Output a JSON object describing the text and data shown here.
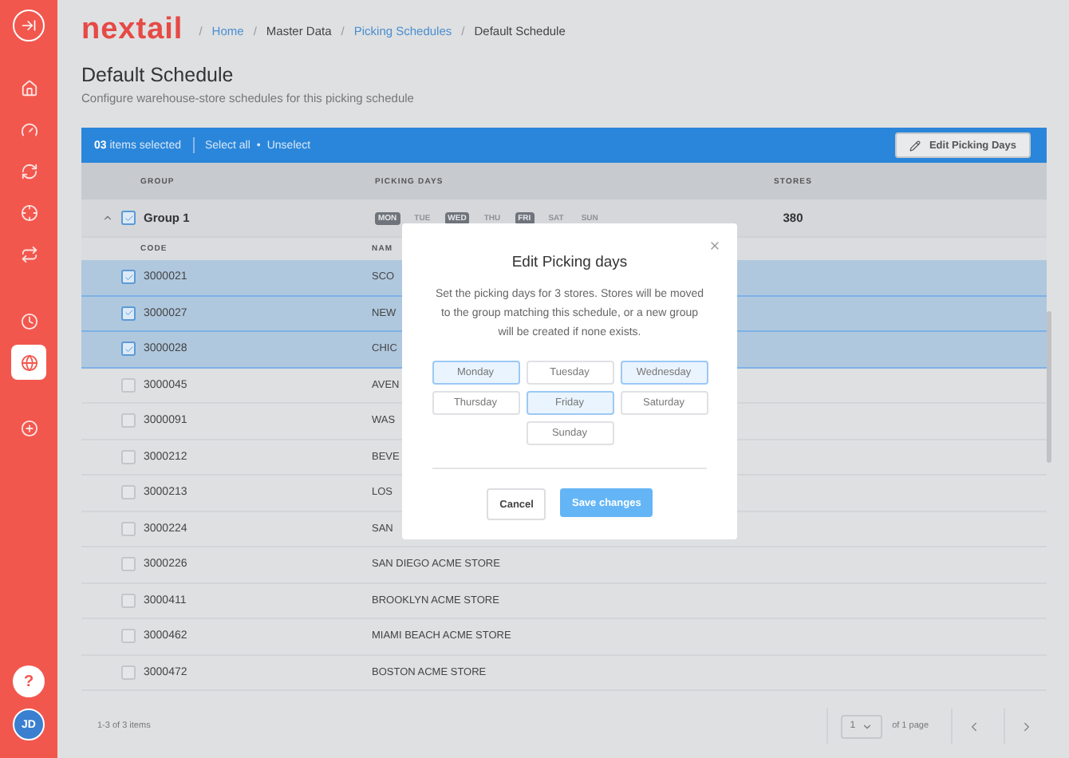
{
  "sidebar": {
    "items": [
      {
        "kind": "home",
        "selected": false
      },
      {
        "kind": "gauge",
        "selected": false
      },
      {
        "kind": "refresh",
        "selected": false
      },
      {
        "kind": "target",
        "selected": false
      },
      {
        "kind": "repeat",
        "selected": false
      },
      {
        "kind": "clock",
        "selected": false
      },
      {
        "kind": "globe",
        "selected": true
      },
      {
        "kind": "plus",
        "selected": false
      }
    ],
    "help": "?",
    "avatar": "JD"
  },
  "header": {
    "logo": "nextail",
    "separator": "/",
    "breadcrumb": [
      {
        "label": "Home",
        "link": true
      },
      {
        "label": "Master Data",
        "link": false
      },
      {
        "label": "Picking Schedules",
        "link": true
      },
      {
        "label": "Default Schedule",
        "link": false
      }
    ]
  },
  "page": {
    "title": "Default Schedule",
    "subtitle": "Configure warehouse-store schedules for this picking schedule"
  },
  "selection_bar": {
    "count": "03",
    "count_label": "items selected",
    "select_all": "Select all",
    "separator": "•",
    "unselect": "Unselect",
    "action": "Edit Picking Days"
  },
  "table": {
    "columns": [
      "GROUP",
      "PICKING DAYS",
      "STORES"
    ],
    "group": {
      "name": "Group 1",
      "expanded": true,
      "checked": true,
      "stores": "380",
      "days": [
        {
          "label": "MON",
          "selected": true
        },
        {
          "label": "TUE",
          "selected": false
        },
        {
          "label": "WED",
          "selected": true
        },
        {
          "label": "THU",
          "selected": false
        },
        {
          "label": "FRI",
          "selected": true
        },
        {
          "label": "SAT",
          "selected": false
        },
        {
          "label": "SUN",
          "selected": false
        }
      ]
    },
    "sub_columns": [
      "CODE",
      "NAM"
    ],
    "rows": [
      {
        "code": "3000021",
        "name": "SCO",
        "checked": true
      },
      {
        "code": "3000027",
        "name": "NEW",
        "checked": true
      },
      {
        "code": "3000028",
        "name": "CHIC",
        "checked": true
      },
      {
        "code": "3000045",
        "name": "AVEN",
        "checked": false
      },
      {
        "code": "3000091",
        "name": "WAS",
        "checked": false
      },
      {
        "code": "3000212",
        "name": "BEVE",
        "checked": false
      },
      {
        "code": "3000213",
        "name": "LOS",
        "checked": false
      },
      {
        "code": "3000224",
        "name": "SAN",
        "checked": false
      },
      {
        "code": "3000226",
        "name": "SAN DIEGO ACME STORE",
        "checked": false
      },
      {
        "code": "3000411",
        "name": "BROOKLYN ACME STORE",
        "checked": false
      },
      {
        "code": "3000462",
        "name": "MIAMI BEACH ACME STORE",
        "checked": false
      },
      {
        "code": "3000472",
        "name": "BOSTON ACME STORE",
        "checked": false
      }
    ],
    "summary": "1-3 of 3 items",
    "page_select": "1",
    "page_total": "of 1 page"
  },
  "dialog": {
    "title": "Edit Picking days",
    "text": "Set the picking days for 3 stores. Stores will be moved to the group matching this schedule, or a new group will be created if none exists.",
    "days": [
      {
        "label": "Monday",
        "selected": true
      },
      {
        "label": "Tuesday",
        "selected": false
      },
      {
        "label": "Wednesday",
        "selected": true
      },
      {
        "label": "Thursday",
        "selected": false
      },
      {
        "label": "Friday",
        "selected": true
      },
      {
        "label": "Saturday",
        "selected": false
      },
      {
        "label": "Sunday",
        "selected": false
      }
    ],
    "cancel": "Cancel",
    "save": "Save changes"
  }
}
